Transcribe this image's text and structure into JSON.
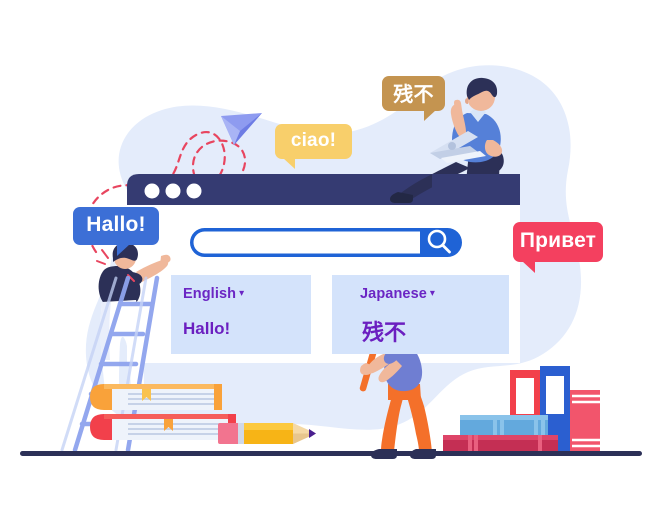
{
  "illustration": {
    "title": "Language translation app illustration",
    "palette": {
      "background": "#ffffff",
      "blob": "#e4ecfb",
      "browser_header": "#353b72",
      "accent_blue": "#1f63d6",
      "card_background": "#d4e3fb",
      "card_text_purple": "#6b26c4",
      "bubble_blue": "#3c6fd6",
      "bubble_yellow": "#f8cf6b",
      "bubble_ochre": "#c49450",
      "bubble_pink": "#f4405f",
      "ground_line": "#2c3057",
      "pencil_yellow": "#f7b416",
      "book_red": "#f2404b",
      "book_orange": "#f9a23a",
      "trail_red": "#e8455f",
      "paper_plane": "#7a87e8"
    }
  },
  "browser_window": {
    "dots": [
      "window-dot",
      "window-dot",
      "window-dot"
    ],
    "search": {
      "placeholder": "",
      "value": "",
      "button_icon": "search-icon"
    }
  },
  "translator": {
    "source": {
      "language": "English",
      "caret": "▾",
      "text": "Hallo!"
    },
    "target": {
      "language": "Japanese",
      "caret": "▾",
      "text": "残不"
    }
  },
  "speech_bubbles": [
    {
      "id": "hallo",
      "text": "Hallo!",
      "color": "#3c6fd6"
    },
    {
      "id": "ciao",
      "text": "ciao!",
      "color": "#f8cf6b"
    },
    {
      "id": "japanese",
      "text": "残不",
      "color": "#c49450"
    },
    {
      "id": "privet",
      "text": "Привет",
      "color": "#f4405f"
    }
  ],
  "scene_objects": {
    "person_laptop": "person-sitting-with-laptop",
    "person_ladder": "person-on-ladder",
    "person_magnifier": "person-holding-magnifier",
    "paper_plane": "paper-plane-icon",
    "dashed_trail": "dashed-flight-path",
    "book_stack_left": "stack-of-books",
    "pencil": "pencil-icon",
    "book_stack_right": "stack-of-books",
    "ladder": "ladder",
    "ground": "ground-line"
  }
}
